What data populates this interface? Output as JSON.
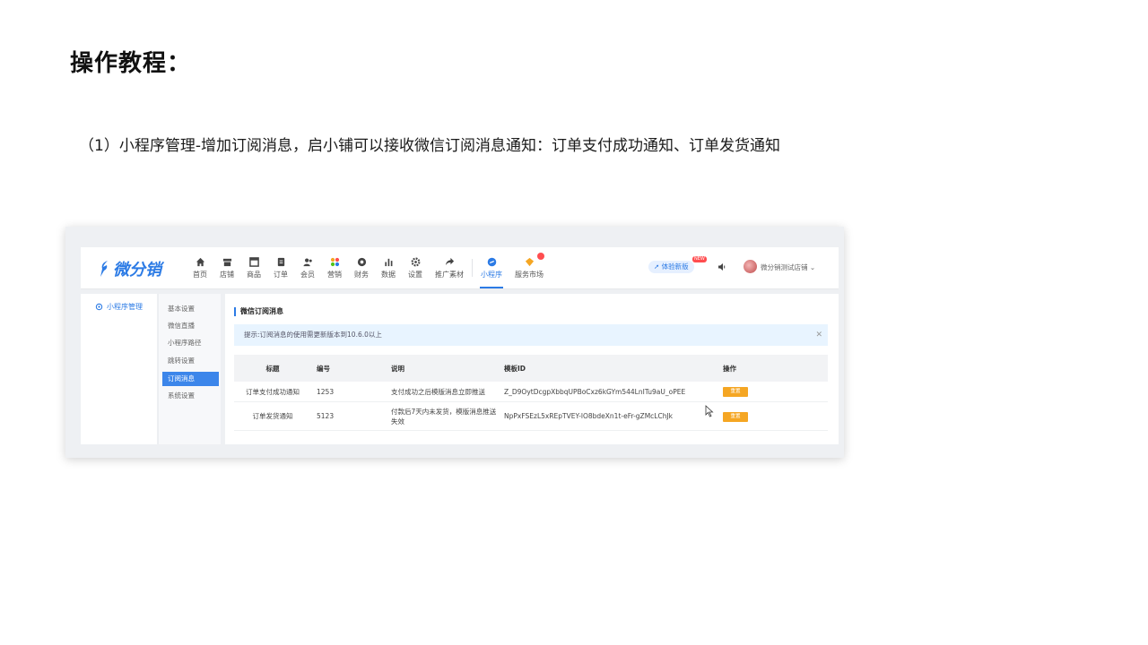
{
  "heading": "操作教程：",
  "step_text": "（1）小程序管理-增加订阅消息，启小铺可以接收微信订阅消息通知：订单支付成功通知、订单发货通知",
  "app": {
    "logo_text": "微分销",
    "nav": [
      {
        "label": "首页",
        "icon": "home-icon"
      },
      {
        "label": "店铺",
        "icon": "store-icon"
      },
      {
        "label": "商品",
        "icon": "goods-icon"
      },
      {
        "label": "订单",
        "icon": "order-icon"
      },
      {
        "label": "会员",
        "icon": "member-icon"
      },
      {
        "label": "营销",
        "icon": "marketing-icon"
      },
      {
        "label": "财务",
        "icon": "finance-icon"
      },
      {
        "label": "数据",
        "icon": "data-icon"
      },
      {
        "label": "设置",
        "icon": "settings-icon"
      },
      {
        "label": "推广素材",
        "icon": "share-icon"
      },
      {
        "label": "小程序",
        "icon": "miniprogram-icon"
      },
      {
        "label": "服务市场",
        "icon": "service-market-icon"
      }
    ],
    "active_nav": "小程序",
    "trial_label": "体验新版",
    "new_tag": "NEW",
    "shop_name": "微分销测试店铺",
    "sidebar_title": "小程序管理",
    "sub_menu": [
      "基本设置",
      "微信直播",
      "小程序路径",
      "跳转设置",
      "订阅消息",
      "系统设置"
    ],
    "active_sub": "订阅消息",
    "section_title": "微信订阅消息",
    "alert_text": "提示:订阅消息的使用需更新版本到10.6.0以上",
    "table": {
      "headers": [
        "标题",
        "编号",
        "说明",
        "模板ID",
        "操作"
      ],
      "rows": [
        {
          "title": "订单支付成功通知",
          "code": "1253",
          "desc": "支付成功之后模版消息立即推送",
          "template_id": "Z_D9OytDcgpXbbqUPBoCxz6kGYm544LnITu9aU_oPEE",
          "action": "重置"
        },
        {
          "title": "订单发货通知",
          "code": "5123",
          "desc": "付款后7天内未发货，模版消息推送失效",
          "template_id": "NpPxFSEzL5xREpTVEY-lO8bdeXn1t-eFr-gZMcLChJk",
          "action": "重置"
        }
      ]
    }
  },
  "colors": {
    "brand": "#2c7be5",
    "action": "#f5a623",
    "alert_bg": "#e8f4ff"
  }
}
